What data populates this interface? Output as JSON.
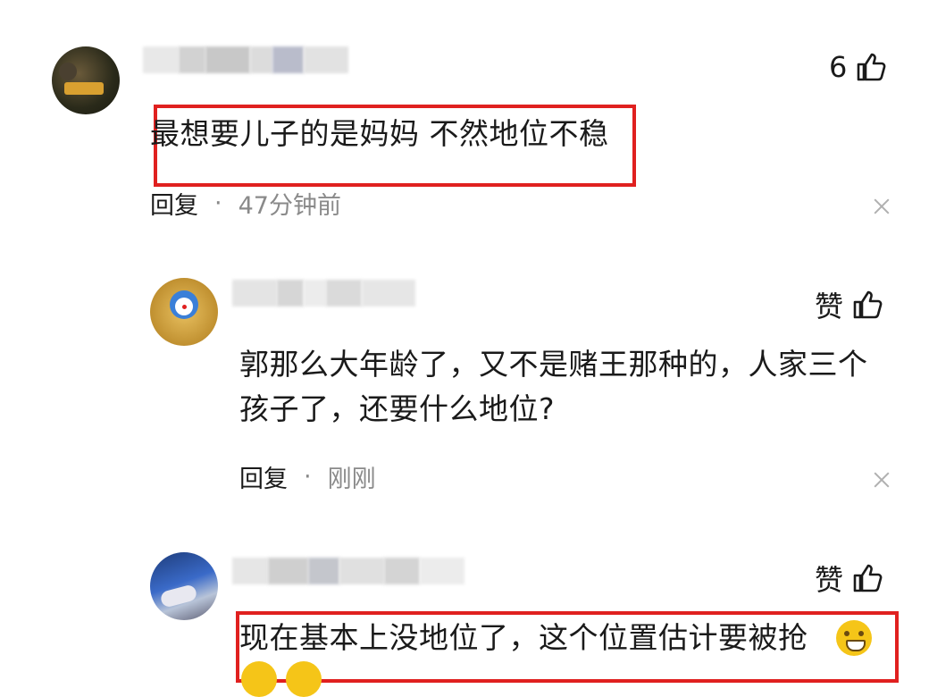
{
  "comments": [
    {
      "like_value": "6",
      "text": "最想要儿子的是妈妈 不然地位不稳",
      "reply_label": "回复",
      "separator": "·",
      "time": "47分钟前"
    },
    {
      "like_value": "赞",
      "text_line1": "郭那么大年龄了，又不是赌王那种的，人家三个",
      "text_line2": "孩子了，还要什么地位?",
      "reply_label": "回复",
      "separator": "·",
      "time": "刚刚"
    },
    {
      "like_value": "赞",
      "text": "现在基本上没地位了，这个位置估计要被抢"
    }
  ],
  "icons": {
    "like": "thumbs-up-icon",
    "close": "close-icon",
    "emoji": "emoji-icon"
  },
  "colors": {
    "highlight_border": "#e0201f",
    "meta_gray": "#8a8a8a"
  }
}
